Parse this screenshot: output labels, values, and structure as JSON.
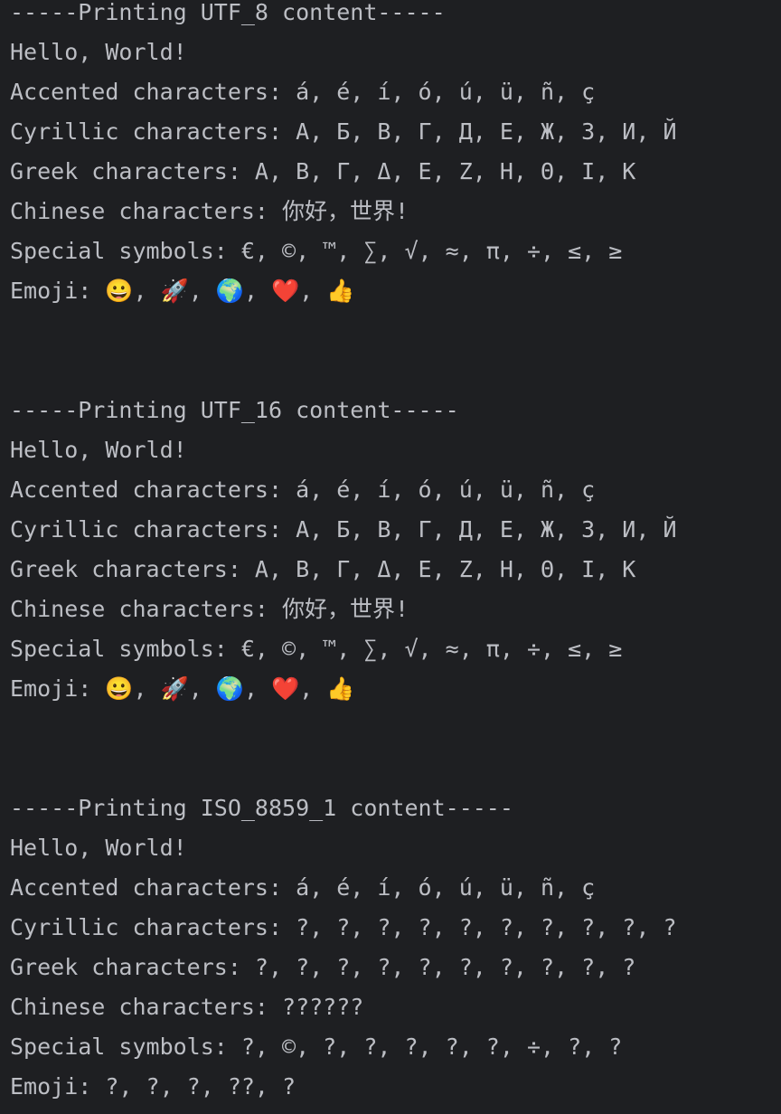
{
  "console": {
    "sections": [
      {
        "header": "-----Printing UTF_8 content-----",
        "lines": [
          "Hello, World!",
          "Accented characters: á, é, í, ó, ú, ü, ñ, ç",
          "Cyrillic characters: А, Б, В, Г, Д, Е, Ж, З, И, Й",
          "Greek characters: Α, Β, Γ, Δ, Ε, Ζ, Η, Θ, Ι, Κ",
          "Chinese characters: 你好，世界!",
          "Special symbols: €, ©, ™, ∑, √, ≈, π, ÷, ≤, ≥",
          "Emoji: 😀, 🚀, 🌍, ❤️, 👍"
        ]
      },
      {
        "header": "-----Printing UTF_16 content-----",
        "lines": [
          "Hello, World!",
          "Accented characters: á, é, í, ó, ú, ü, ñ, ç",
          "Cyrillic characters: А, Б, В, Г, Д, Е, Ж, З, И, Й",
          "Greek characters: Α, Β, Γ, Δ, Ε, Ζ, Η, Θ, Ι, Κ",
          "Chinese characters: 你好，世界!",
          "Special symbols: €, ©, ™, ∑, √, ≈, π, ÷, ≤, ≥",
          "Emoji: 😀, 🚀, 🌍, ❤️, 👍"
        ]
      },
      {
        "header": "-----Printing ISO_8859_1 content-----",
        "lines": [
          "Hello, World!",
          "Accented characters: á, é, í, ó, ú, ü, ñ, ç",
          "Cyrillic characters: ?, ?, ?, ?, ?, ?, ?, ?, ?, ?",
          "Greek characters: ?, ?, ?, ?, ?, ?, ?, ?, ?, ?",
          "Chinese characters: ??????",
          "Special symbols: ?, ©, ?, ?, ?, ?, ?, ÷, ?, ?",
          "Emoji: ?, ?, ?, ??, ?"
        ]
      }
    ]
  }
}
